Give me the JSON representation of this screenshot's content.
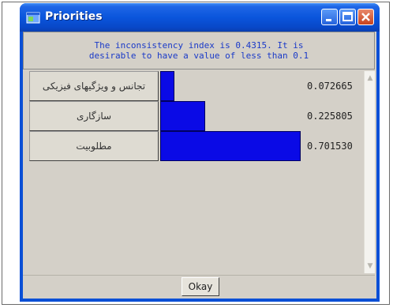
{
  "window": {
    "title": "Priorities",
    "title_color": "#ffffff",
    "titlebar_color": "#0a55dc"
  },
  "message": {
    "line1": "The inconsistency index is 0.4315.  It is",
    "line2": "desirable to have a value of less than 0.1",
    "color": "#1a3ac8"
  },
  "priorities": [
    {
      "label": "تجانس و ویژگیهای فیزیکی",
      "value": "0.072665",
      "weight": 0.072665
    },
    {
      "label": "سازگاری",
      "value": "0.225805",
      "weight": 0.225805
    },
    {
      "label": "مطلوبیت",
      "value": "0.701530",
      "weight": 0.70153
    }
  ],
  "bar_color": "#0a0ae6",
  "buttons": {
    "okay": "Okay"
  },
  "icons": {
    "app": "app-window-icon",
    "minimize": "minimize-icon",
    "maximize": "maximize-icon",
    "close": "close-icon",
    "scroll_up": "scroll-up-arrow-icon",
    "scroll_down": "scroll-down-arrow-icon"
  }
}
